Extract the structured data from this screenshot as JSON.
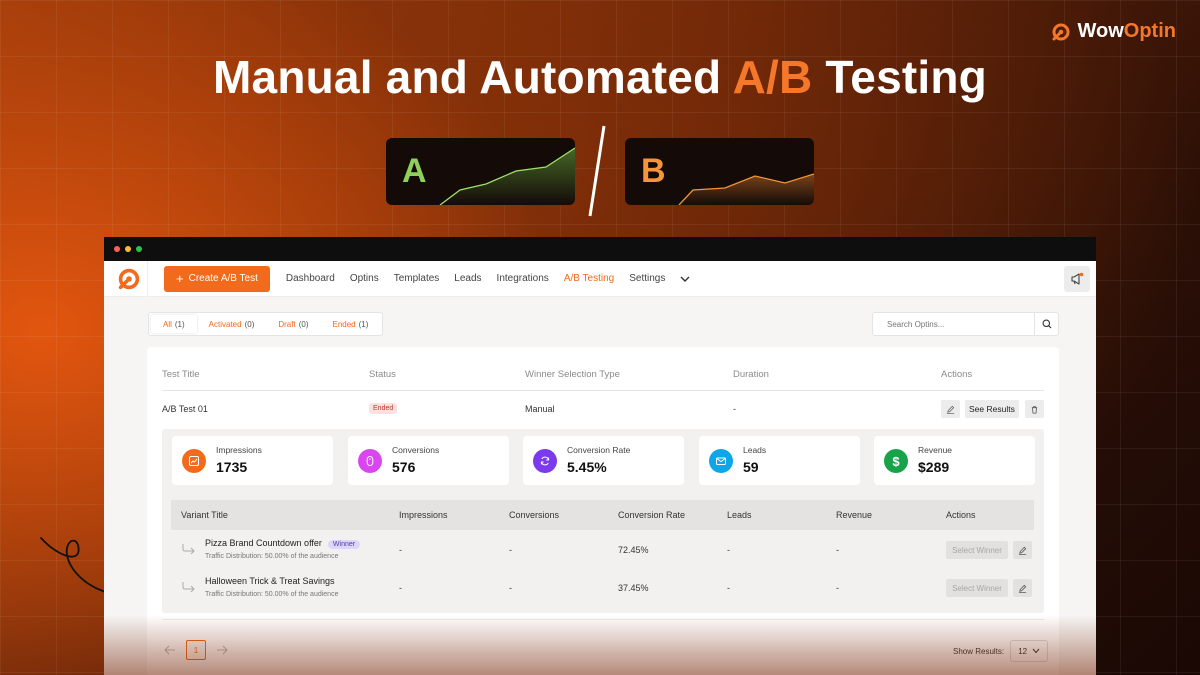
{
  "brand": {
    "name_part1": "Wow",
    "name_part2": "Optin"
  },
  "headline": {
    "part1": "Manual and Automated ",
    "accent": "A/B",
    "part2": " Testing"
  },
  "variant_cards": [
    {
      "letter": "A",
      "color": "#8ed15a"
    },
    {
      "letter": "B",
      "color": "#f4953a"
    }
  ],
  "colors": {
    "accent": "#f26a1b",
    "winner_badge": "#ddd6fb",
    "ended_badge": "#fde1e1"
  },
  "nav": {
    "create_label": "Create A/B Test",
    "links": [
      "Dashboard",
      "Optins",
      "Templates",
      "Leads",
      "Integrations",
      "A/B Testing",
      "Settings"
    ],
    "active": "A/B Testing"
  },
  "filters": [
    {
      "label": "All",
      "count": "(1)"
    },
    {
      "label": "Activated",
      "count": "(0)"
    },
    {
      "label": "Draft",
      "count": "(0)"
    },
    {
      "label": "Ended",
      "count": "(1)"
    }
  ],
  "search": {
    "placeholder": "Search Optins..."
  },
  "table": {
    "headers": [
      "Test Title",
      "Status",
      "Winner Selection Type",
      "Duration",
      "Actions"
    ],
    "row": {
      "title": "A/B Test 01",
      "status": "Ended",
      "winner_type": "Manual",
      "duration": "-",
      "see_results": "See Results"
    }
  },
  "stats": [
    {
      "label": "Impressions",
      "value": "1735",
      "icon": "chart-icon",
      "color": "#f26a1b"
    },
    {
      "label": "Conversions",
      "value": "576",
      "icon": "mouse-icon",
      "color": "#d946ef"
    },
    {
      "label": "Conversion Rate",
      "value": "5.45%",
      "icon": "refresh-icon",
      "color": "#7c3aed"
    },
    {
      "label": "Leads",
      "value": "59",
      "icon": "mail-icon",
      "color": "#0ea5e9"
    },
    {
      "label": "Revenue",
      "value": "$289",
      "icon": "dollar-icon",
      "color": "#16a34a"
    }
  ],
  "variants": {
    "headers": [
      "Variant Title",
      "Impressions",
      "Conversions",
      "Conversion Rate",
      "Leads",
      "Revenue",
      "Actions"
    ],
    "rows": [
      {
        "title": "Pizza Brand Countdown offer",
        "badge": "Winner",
        "distribution": "Traffic Distribution: 50.00% of the audience",
        "impressions": "-",
        "conversions": "-",
        "rate": "72.45%",
        "leads": "-",
        "revenue": "-",
        "action": "Select Winner"
      },
      {
        "title": "Halloween Trick & Treat Savings",
        "badge": "",
        "distribution": "Traffic Distribution: 50.00% of the audience",
        "impressions": "-",
        "conversions": "-",
        "rate": "37.45%",
        "leads": "-",
        "revenue": "-",
        "action": "Select Winner"
      }
    ]
  },
  "pagination": {
    "current": "1",
    "show_label": "Show Results:",
    "per_page": "12"
  }
}
